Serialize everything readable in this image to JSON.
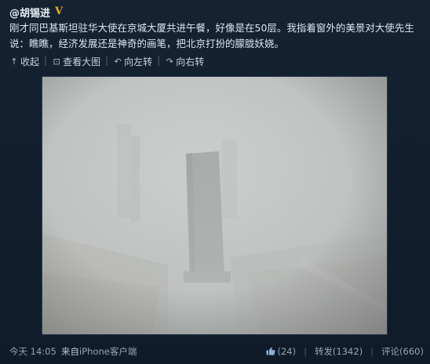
{
  "post": {
    "author": "@胡锡进",
    "verified_badge": "V",
    "text": "刚才同巴基斯坦驻华大使在京城大厦共进午餐，好像是在50层。我指着窗外的美景对大使先生说：瞧瞧，经济发展还是神奇的画笔，把北京打扮的朦胧妖娆。"
  },
  "actions": {
    "collapse": "收起",
    "view_large": "查看大图",
    "rotate_left": "向左转",
    "rotate_right": "向右转"
  },
  "footer": {
    "time": "今天 14:05",
    "source_prefix": "来自",
    "source_link": "iPhone客户端",
    "likes": "(24)",
    "reposts": "转发(1342)",
    "comments": "评论(660)"
  },
  "icons": [
    "collapse-icon",
    "zoom-icon",
    "rotate-left-icon",
    "rotate-right-icon",
    "thumbs-up-icon",
    "verified-badge-icon"
  ]
}
